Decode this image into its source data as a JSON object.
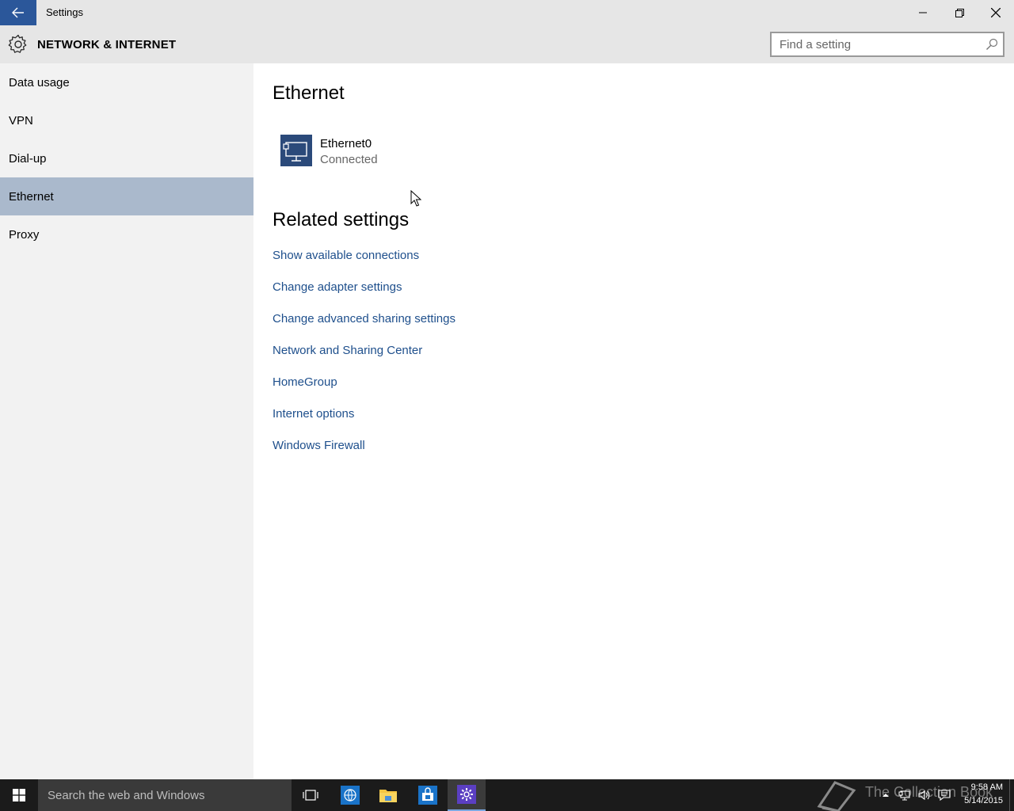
{
  "window": {
    "title": "Settings"
  },
  "header": {
    "title": "NETWORK & INTERNET",
    "search_placeholder": "Find a setting"
  },
  "sidebar": {
    "items": [
      {
        "label": "Data usage",
        "active": false
      },
      {
        "label": "VPN",
        "active": false
      },
      {
        "label": "Dial-up",
        "active": false
      },
      {
        "label": "Ethernet",
        "active": true
      },
      {
        "label": "Proxy",
        "active": false
      }
    ]
  },
  "main": {
    "heading": "Ethernet",
    "connection": {
      "name": "Ethernet0",
      "status": "Connected",
      "icon": "ethernet-icon"
    },
    "related_heading": "Related settings",
    "links": [
      "Show available connections",
      "Change adapter settings",
      "Change advanced sharing settings",
      "Network and Sharing Center",
      "HomeGroup",
      "Internet options",
      "Windows Firewall"
    ]
  },
  "taskbar": {
    "search_placeholder": "Search the web and Windows",
    "time": "9:58 AM",
    "date": "5/14/2015",
    "watermark": "The Collection Book"
  },
  "colors": {
    "accent": "#2b579a",
    "sidebar_active": "#aab9cc",
    "link": "#1e4f8c",
    "taskbar": "#1b1b1b"
  }
}
